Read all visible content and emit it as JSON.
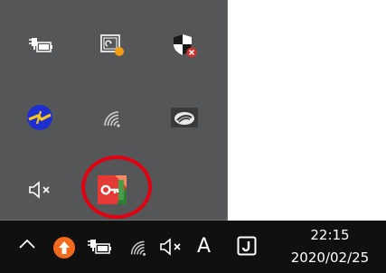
{
  "tray_popup": {
    "icons": [
      {
        "name": "battery-plugged-icon"
      },
      {
        "name": "tablet-update-icon"
      },
      {
        "name": "security-shield-icon"
      },
      {
        "name": "network-status-icon"
      },
      {
        "name": "wifi-icon"
      },
      {
        "name": "cloud-sync-icon"
      },
      {
        "name": "volume-muted-icon"
      },
      {
        "name": "key-app-icon"
      }
    ],
    "highlight_color": "#e00012"
  },
  "taskbar": {
    "ime_label": "A",
    "time": "22:15",
    "date": "2020/02/25",
    "icons": [
      {
        "name": "chevron-up-icon"
      },
      {
        "name": "update-arrow-icon"
      },
      {
        "name": "battery-icon"
      },
      {
        "name": "wifi-icon"
      },
      {
        "name": "volume-muted-icon"
      },
      {
        "name": "ime-mode-icon"
      },
      {
        "name": "japanese-input-icon"
      }
    ],
    "background": "#101010"
  }
}
